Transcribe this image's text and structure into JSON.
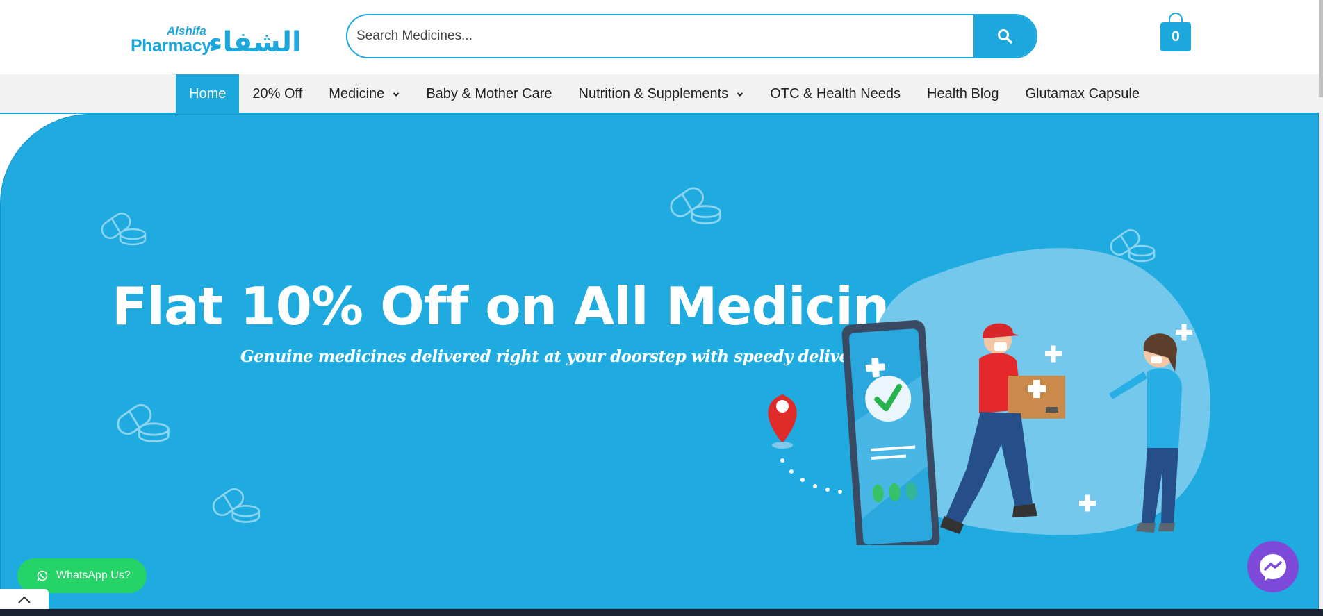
{
  "header": {
    "logo": {
      "latin_line1": "Alshifa",
      "latin_line2": "Pharmacy",
      "arabic_text": "الشفاء"
    },
    "search": {
      "placeholder": "Search Medicines...",
      "button_icon": "search-icon"
    },
    "cart": {
      "count": "0",
      "icon": "shopping-bag-icon"
    }
  },
  "nav": {
    "items": [
      {
        "label": "Home",
        "active": true
      },
      {
        "label": "20% Off"
      },
      {
        "label": "Medicine",
        "has_dropdown": true
      },
      {
        "label": "Baby & Mother Care"
      },
      {
        "label": "Nutrition & Supplements",
        "has_dropdown": true
      },
      {
        "label": "OTC & Health Needs"
      },
      {
        "label": "Health Blog"
      },
      {
        "label": "Glutamax Capsule"
      }
    ]
  },
  "hero": {
    "title": "Flat 10% Off on All Medicines",
    "subtitle": "Genuine medicines delivered right at your doorstep with speedy delivery."
  },
  "floating": {
    "whatsapp_label": "WhatsApp Us?",
    "whatsapp_icon": "whatsapp-icon",
    "messenger_icon": "messenger-icon",
    "scroll_top_icon": "chevron-up-icon"
  },
  "colors": {
    "brand": "#1ca8dd",
    "hero_bg": "#1fabe0",
    "whatsapp": "#25d366",
    "messenger": "#7d4ad9"
  }
}
